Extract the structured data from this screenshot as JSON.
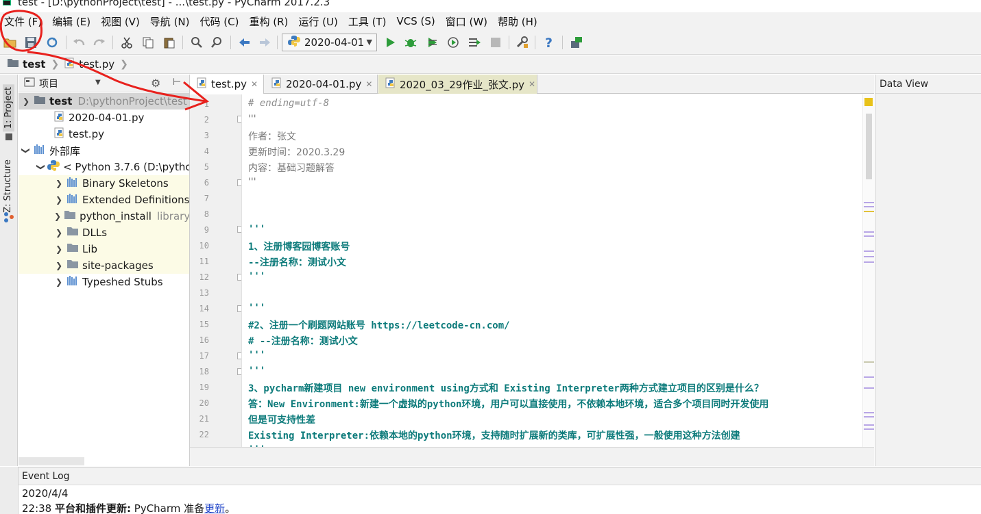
{
  "window": {
    "title": "test - [D:\\pythonProject\\test] - ...\\test.py - PyCharm 2017.2.3"
  },
  "menu": [
    "文件 (F)",
    "编辑 (E)",
    "视图 (V)",
    "导航 (N)",
    "代码 (C)",
    "重构 (R)",
    "运行 (U)",
    "工具 (T)",
    "VCS (S)",
    "窗口 (W)",
    "帮助 (H)"
  ],
  "toolbar": {
    "run_config": "2020-04-01",
    "icons": [
      "open-folder-icon",
      "save-icon",
      "sync-icon",
      "undo-icon",
      "redo-icon",
      "cut-icon",
      "copy-icon",
      "paste-icon",
      "find-icon",
      "replace-icon",
      "back-icon",
      "forward-icon",
      "run-icon",
      "debug-icon",
      "coverage-icon",
      "profile-icon",
      "concurrency-icon",
      "stop-icon",
      "settings-icon",
      "help-icon",
      "sdk-icon"
    ]
  },
  "breadcrumb": [
    "test",
    "test.py"
  ],
  "side_tabs": [
    "1: Project",
    "Z: Structure"
  ],
  "project_panel": {
    "title": "项目",
    "tree": [
      {
        "label": "test",
        "hint": "D:\\pythonProject\\test"
      },
      {
        "label": "2020-04-01.py",
        "hint": ""
      },
      {
        "label": "test.py",
        "hint": ""
      },
      {
        "label": "外部库",
        "hint": ""
      },
      {
        "label": "< Python 3.7.6 (D:\\python",
        "hint": ""
      },
      {
        "label": "Binary Skeletons",
        "hint": ""
      },
      {
        "label": "Extended Definitions",
        "hint": ""
      },
      {
        "label": "python_install",
        "hint": "library"
      },
      {
        "label": "DLLs",
        "hint": ""
      },
      {
        "label": "Lib",
        "hint": ""
      },
      {
        "label": "site-packages",
        "hint": ""
      },
      {
        "label": "Typeshed Stubs",
        "hint": ""
      }
    ]
  },
  "editor_tabs": [
    "test.py",
    "2020-04-01.py",
    "2020_03_29作业_张文.py"
  ],
  "code_lines": [
    "# ending=utf-8",
    "'''",
    "作者：张文",
    "更新时间：2020.3.29",
    "内容：基础习题解答",
    "'''",
    "",
    "",
    "'''",
    "1、注册博客园博客账号",
    "--注册名称：测试小文",
    "'''",
    "",
    "'''",
    "#2、注册一个刷题网站账号 https://leetcode-cn.com/",
    "# --注册名称：测试小文",
    "'''",
    "'''",
    "3、pycharm新建项目 new environment using方式和 Existing Interpreter两种方式建立项目的区别是什么？",
    "答：New Environment:新建一个虚拟的python环境，用户可以直接使用，不依赖本地环境，适合多个项目同时开发使用",
    "但是可支持性差",
    "Existing Interpreter:依赖本地的python环境，支持随时扩展新的类库，可扩展性强，一般使用这种方法创建",
    "'''"
  ],
  "line_numbers": [
    "1",
    "2",
    "3",
    "4",
    "5",
    "6",
    "7",
    "8",
    "9",
    "10",
    "11",
    "12",
    "13",
    "14",
    "15",
    "16",
    "17",
    "18",
    "19",
    "20",
    "21",
    "22"
  ],
  "data_view": {
    "title": "Data View"
  },
  "event_log": {
    "title": "Event Log",
    "date": "2020/4/4",
    "time": "22:38",
    "bold_text": "平台和插件更新:",
    "text": " PyCharm 准备",
    "link": "更新",
    "tail": "。"
  },
  "colors": {
    "annotation": "#e8211d",
    "code_teal": "#0d7b7b",
    "selection": "#d5d5d5",
    "library_bg": "#fcfbe6"
  }
}
